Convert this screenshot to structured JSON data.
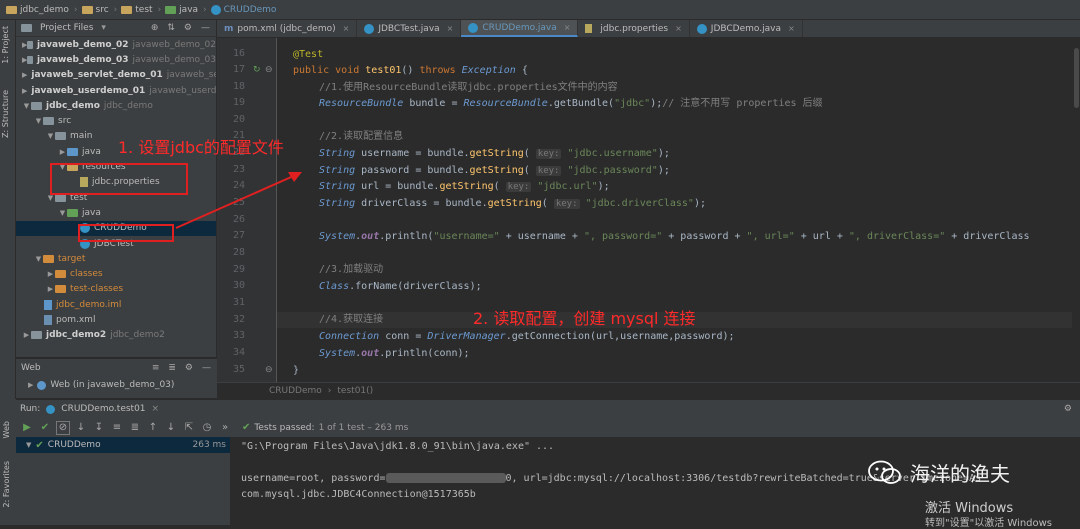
{
  "breadcrumb": [
    "jdbc_demo",
    "src",
    "test",
    "java",
    "CRUDDemo"
  ],
  "left_strip": {
    "project_tab": "1: Project",
    "structure_tab": "Z: Structure",
    "web_tab": "Web",
    "favorites_tab": "2: Favorites"
  },
  "project_panel": {
    "title": "Project Files",
    "tree": [
      {
        "label": "javaweb_demo_02",
        "hint": "javaweb_demo_02"
      },
      {
        "label": "javaweb_demo_03",
        "hint": "javaweb_demo_03"
      },
      {
        "label": "javaweb_servlet_demo_01",
        "hint": "javaweb_se"
      },
      {
        "label": "javaweb_userdemo_01",
        "hint": "javaweb_userde"
      },
      {
        "label": "jdbc_demo",
        "hint": "jdbc_demo"
      },
      {
        "label": "src"
      },
      {
        "label": "main"
      },
      {
        "label": "java"
      },
      {
        "label": "resources"
      },
      {
        "label": "jdbc.properties"
      },
      {
        "label": "test"
      },
      {
        "label": "java"
      },
      {
        "label": "CRUDDemo"
      },
      {
        "label": "JDBCTest"
      },
      {
        "label": "target"
      },
      {
        "label": "classes"
      },
      {
        "label": "test-classes"
      },
      {
        "label": "jdbc_demo.iml"
      },
      {
        "label": "pom.xml"
      },
      {
        "label": "jdbc_demo2",
        "hint": "jdbc_demo2"
      }
    ]
  },
  "web_panel": {
    "title": "Web",
    "item": "Web (in javaweb_demo_03)"
  },
  "tabs": [
    {
      "label": "pom.xml (jdbc_demo)",
      "icon": "maven"
    },
    {
      "label": "JDBCTest.java",
      "icon": "class"
    },
    {
      "label": "CRUDDemo.java",
      "icon": "class",
      "active": true
    },
    {
      "label": "jdbc.properties",
      "icon": "properties"
    },
    {
      "label": "JDBCDemo.java",
      "icon": "class"
    }
  ],
  "line_numbers": [
    "16",
    "17",
    "18",
    "19",
    "20",
    "21",
    "22",
    "23",
    "24",
    "25",
    "26",
    "27",
    "28",
    "29",
    "30",
    "31",
    "32",
    "33",
    "34",
    "35"
  ],
  "code": {
    "l16": "@Test",
    "l17_kw1": "public",
    "l17_kw2": "void",
    "l17_name": "test01",
    "l17_kw3": "throws",
    "l17_exc": "Exception",
    "l18": "//1.使用ResourceBundle读取jdbc.properties文件中的内容",
    "l19_cls": "ResourceBundle",
    "l19_var": "bundle",
    "l19_m": "getBundle",
    "l19_str": "\"jdbc\"",
    "l19_cmt": "// 注意不用写 properties 后缀",
    "l21": "//2.读取配置信息",
    "hint_key": "key:",
    "l22_var": "username",
    "l22_str": "\"jdbc.username\"",
    "l23_var": "password",
    "l23_str": "\"jdbc.password\"",
    "l24_var": "url",
    "l24_str": "\"jdbc.url\"",
    "l25_var": "driverClass",
    "l25_str": "\"jdbc.driverClass\"",
    "type_string": "String",
    "getString": "getString",
    "l27_sys": "System",
    "l27_out": "out",
    "l27_println": "println",
    "l27_s1": "\"username=\"",
    "l27_s2": "\", password=\"",
    "l27_s3": "\", url=\"",
    "l27_s4": "\", driverClass=\"",
    "l29": "//3.加载驱动",
    "l30_cls": "Class",
    "l30_m": "forName",
    "l30_arg": "driverClass",
    "l32": "//4.获取连接",
    "l33_cls": "Connection",
    "l33_var": "conn",
    "l33_dm": "DriverManager",
    "l33_m": "getConnection",
    "l33_args": "url,username,password",
    "l34_arg": "conn"
  },
  "editor_breadcrumb": [
    "CRUDDemo",
    "test01()"
  ],
  "annotations": {
    "note1": "1. 设置jdbc的配置文件",
    "note2": "2. 读取配置，创建 mysql 连接"
  },
  "run": {
    "title": "Run:",
    "config": "CRUDDemo.test01",
    "status_prefix": "Tests passed:",
    "status_rest": "1 of 1 test – 263 ms",
    "tree_item": "CRUDDemo",
    "tree_time": "263 ms",
    "console": [
      "\"G:\\Program Files\\Java\\jdk1.8.0_91\\bin\\java.exe\" ...",
      "",
      "username=root, password=",
      "0, url=jdbc:mysql://localhost:3306/testdb?rewriteBatched",
      "=true&serverTimezone=As",
      "com.mysql.jdbc.JDBC4Connection@1517365b"
    ]
  },
  "watermark": {
    "title": "海洋的渔夫"
  },
  "activation": {
    "line1": "激活 Windows",
    "line2": "转到\"设置\"以激活 Windows"
  }
}
